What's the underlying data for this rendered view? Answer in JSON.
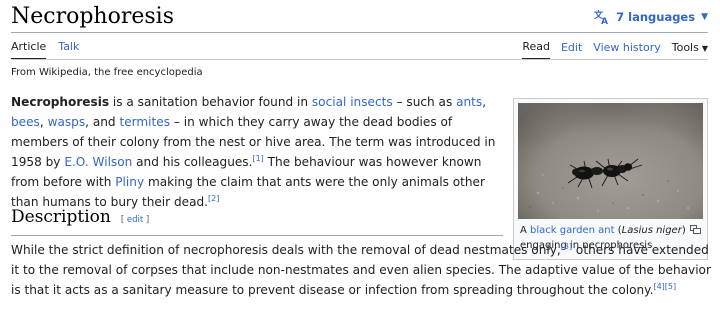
{
  "header": {
    "title": "Necrophoresis",
    "languages_label": "7 languages"
  },
  "tabs": {
    "article": "Article",
    "talk": "Talk",
    "read": "Read",
    "edit": "Edit",
    "view_history": "View history",
    "tools": "Tools"
  },
  "tagline": "From Wikipedia, the free encyclopedia",
  "lead": {
    "term": "Necrophoresis",
    "t1": " is a sanitation behavior found in ",
    "link_social_insects": "social insects",
    "t2": " – such as ",
    "link_ants": "ants",
    "sep1": ", ",
    "link_bees": "bees",
    "sep2": ", ",
    "link_wasps": "wasps",
    "t3": ", and ",
    "link_termites": "termites",
    "t4": " – in which they carry away the dead bodies of members of their colony from the nest or hive area. The term was introduced in 1958 by ",
    "link_eo_wilson": "E.O. Wilson",
    "t5": " and his colleagues.",
    "ref1": "[1]",
    "t6": " The behaviour was however known from before with ",
    "link_pliny": "Pliny",
    "t7": " making the claim that ants were the only animals other than humans to bury their dead.",
    "ref2": "[2]"
  },
  "section": {
    "heading": "Description",
    "edit_open": "[ ",
    "edit_label": "edit",
    "edit_close": " ]",
    "t1": "While the strict definition of necrophoresis deals with the removal of dead nestmates only,",
    "ref3": "[3]",
    "t2": " others have extended it to the removal of corpses that include non-nestmates and even alien species. The adaptive value of the behavior is that it acts as a sanitary measure to prevent disease or infection from spreading throughout the colony.",
    "ref4": "[4]",
    "ref5": "[5]"
  },
  "figure": {
    "cap1": "A ",
    "cap_link": "black garden ant",
    "cap2": " (",
    "cap_species": "Lasius niger",
    "cap3": ")",
    "cap4": "engaging in necrophoresis"
  },
  "colors": {
    "link": "#3366cc",
    "text": "#202122",
    "rule": "#a2a9b1"
  },
  "icons": [
    "translate-icon",
    "chevron-down-icon",
    "enlarge-icon"
  ]
}
